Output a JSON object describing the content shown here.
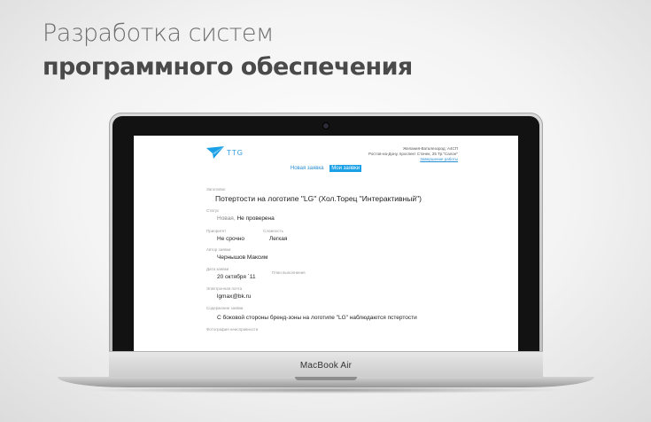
{
  "headline": {
    "line1": "Разработка систем",
    "line2": "программного обеспечения"
  },
  "laptop": {
    "brand": "MacBook Air"
  },
  "screen": {
    "logo_text": "TTG",
    "contact": {
      "line1": "Желания-Ваталезород: А4СП",
      "line2": "Ростов-на-Дону, проспект Стачек, 25 Тр.\"Салон\"",
      "link": "Завершение работы"
    },
    "nav": {
      "new_request": "Новая заявка",
      "my_requests": "Мои заявки"
    },
    "form": {
      "title_label": "Заголовок",
      "title_value": "Потертости на логотипе \"LG\" (Хол.Торец \"Интерактивный\")",
      "status_label": "Статус",
      "status_value_muted": "Новая,",
      "status_value": "Не проверена",
      "priority_label": "Приоритет",
      "priority_value": "Не срочно",
      "complexity_label": "Сложность",
      "complexity_value": "Легкая",
      "author_label": "Автор заявки",
      "author_value": "Чернышов Максим",
      "date_label": "Дата заявки",
      "date_value": "20 октября `11",
      "plan_label": "План выполнения",
      "email_label": "Электронная почта",
      "email_value": "lgmax@bk.ru",
      "content_label": "Содержание заявки",
      "content_value": "С боковой стороны бренд-зоны на логотипе \"LG\" наблюдаются пстертости",
      "photo_label": "Фотография неисправности"
    }
  },
  "colors": {
    "accent": "#1aa0e6",
    "link": "#2b8fd6"
  }
}
